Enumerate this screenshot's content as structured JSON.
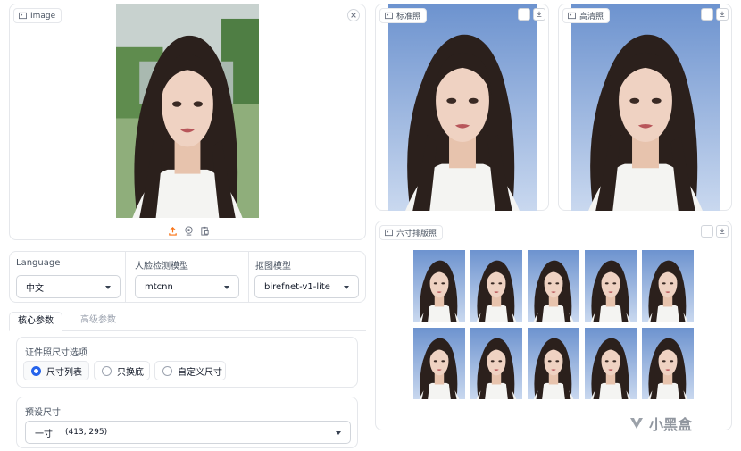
{
  "image_panel": {
    "label": "Image",
    "close_icon": "close-icon",
    "upload_icon": "upload-icon",
    "webcam_icon": "webcam-icon",
    "clipboard_icon": "clipboard-icon"
  },
  "standard_photo": {
    "label": "标准照"
  },
  "hd_photo": {
    "label": "高清照"
  },
  "sheet": {
    "label": "六寸排版照"
  },
  "settings": {
    "language": {
      "label": "Language",
      "value": "中文"
    },
    "face_model": {
      "label": "人脸检测模型",
      "value": "mtcnn"
    },
    "matting_model": {
      "label": "抠图模型",
      "value": "birefnet-v1-lite"
    }
  },
  "tabs": [
    {
      "label": "核心参数",
      "active": true
    },
    {
      "label": "高级参数",
      "active": false
    }
  ],
  "size_options": {
    "label": "证件照尺寸选项",
    "options": [
      {
        "label": "尺寸列表",
        "selected": true
      },
      {
        "label": "只换底",
        "selected": false
      },
      {
        "label": "自定义尺寸",
        "selected": false
      }
    ]
  },
  "preset": {
    "label": "预设尺寸",
    "value": "一寸",
    "dims": "(413, 295)"
  },
  "watermark": "小黑盒",
  "colors": {
    "accent": "#2563eb",
    "orange": "#f97316",
    "sky": "#7a9fd6"
  }
}
